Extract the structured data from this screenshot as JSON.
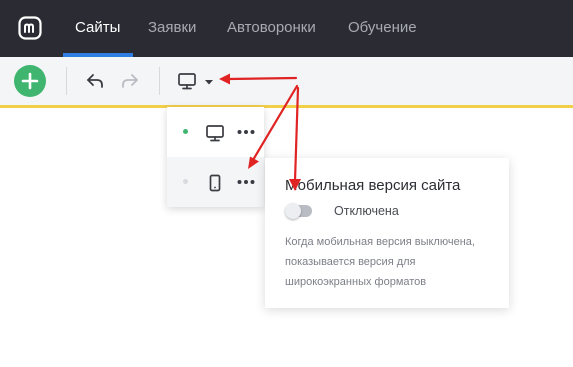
{
  "nav": {
    "tabs": [
      {
        "label": "Сайты",
        "active": true
      },
      {
        "label": "Заявки",
        "active": false
      },
      {
        "label": "Автоворонки",
        "active": false
      },
      {
        "label": "Обучение",
        "active": false
      }
    ]
  },
  "toolbar": {
    "add_icon": "plus-icon",
    "undo_icon": "undo-icon",
    "redo_icon": "redo-icon",
    "device_icon": "desktop-icon",
    "caret_icon": "caret-down-icon"
  },
  "device_menu": {
    "items": [
      {
        "device": "desktop",
        "icon": "desktop-icon",
        "status_color": "#3fb56f"
      },
      {
        "device": "mobile",
        "icon": "mobile-icon",
        "status_color": "#d8dadf"
      }
    ]
  },
  "mobile_panel": {
    "title": "Мобильная версия сайта",
    "toggle_label": "Отключена",
    "toggle_on": false,
    "description": "Когда мобильная версия выключена, показывается версия для широкоэкранных форматов"
  },
  "colors": {
    "topbar": "#2b2c33",
    "active_tab_underline": "#2f7de1",
    "add_button": "#3fb56f",
    "accent_line": "#f2cf49",
    "annotation_arrow": "#e02424"
  }
}
